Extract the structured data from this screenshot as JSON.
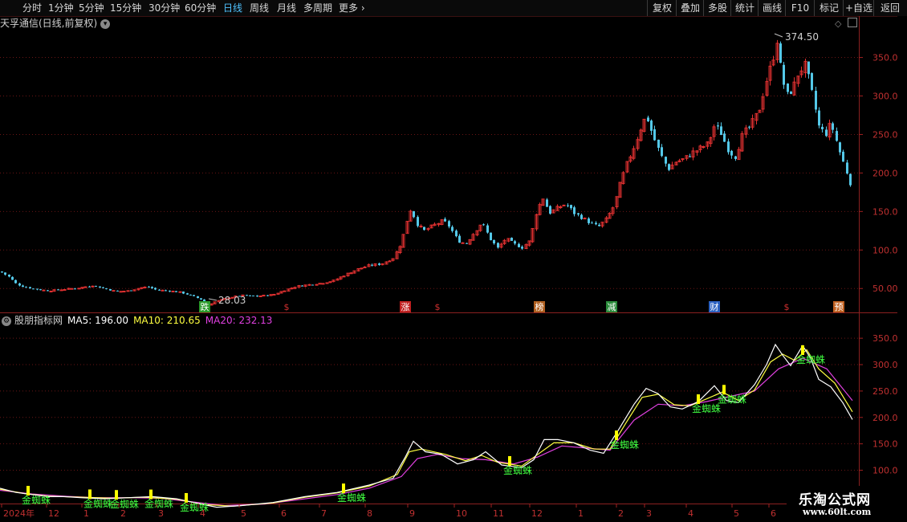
{
  "toolbar": {
    "periods": [
      "分时",
      "1分钟",
      "5分钟",
      "15分钟",
      "30分钟",
      "60分钟",
      "日线",
      "周线",
      "月线",
      "多周期",
      "更多 ›"
    ],
    "active_period": "日线",
    "right_buttons": [
      "复权",
      "叠加",
      "多股",
      "统计",
      "画线",
      "F10",
      "标记",
      "+自选",
      "返回"
    ]
  },
  "main_header": {
    "title": "天孚通信(日线,前复权)"
  },
  "indicator_header": {
    "name": "股朋指标网",
    "ma5": "MA5: 196.00",
    "ma10": "MA10: 210.65",
    "ma20": "MA20: 232.13"
  },
  "colors": {
    "up": "#e03030",
    "down": "#54c8e8",
    "ma5": "#ffffff",
    "ma10": "#ffff40",
    "ma20": "#e040e0",
    "signal_text": "#40ff40",
    "grid": "#6a1515",
    "axis_text": "#c03030"
  },
  "main_axis": {
    "ticks": [
      "350.0",
      "300.0",
      "250.0",
      "200.0",
      "150.0",
      "100.0",
      "50.00"
    ]
  },
  "ind_axis": {
    "ticks": [
      "350.0",
      "300.0",
      "250.0",
      "200.0",
      "150.0",
      "100.0"
    ]
  },
  "annotations": {
    "high_label": "374.50",
    "low_label": "28.03"
  },
  "event_markers": [
    {
      "label": "跌",
      "color": "#2a9a2a"
    },
    {
      "label": "$",
      "color": "#d03030"
    },
    {
      "label": "涨",
      "color": "#c02020"
    },
    {
      "label": "$",
      "color": "#d03030"
    },
    {
      "label": "榜",
      "color": "#b06020"
    },
    {
      "label": "减",
      "color": "#2a8a3a"
    },
    {
      "label": "财",
      "color": "#2a60c0"
    },
    {
      "label": "$",
      "color": "#d03030"
    },
    {
      "label": "预",
      "color": "#c06020"
    }
  ],
  "signal_label": "金蜘蛛",
  "date_axis": [
    "2024年",
    "12",
    "1",
    "2",
    "3",
    "4",
    "5",
    "6",
    "7",
    "8",
    "9",
    "10",
    "11",
    "12",
    "1",
    "2",
    "3",
    "4",
    "5",
    "6"
  ],
  "watermark": {
    "line1": "乐淘公式网",
    "line2": "www.60lt.com"
  },
  "chart_data": {
    "type": "candlestick",
    "main_ylim": [
      20,
      385
    ],
    "indicator_ylim": [
      40,
      370
    ],
    "price_path": [
      [
        0,
        72
      ],
      [
        10,
        66
      ],
      [
        20,
        56
      ],
      [
        30,
        52
      ],
      [
        45,
        49
      ],
      [
        60,
        47
      ],
      [
        80,
        49
      ],
      [
        100,
        51
      ],
      [
        115,
        54
      ],
      [
        130,
        50
      ],
      [
        145,
        46
      ],
      [
        160,
        47
      ],
      [
        175,
        51
      ],
      [
        185,
        52
      ],
      [
        195,
        48
      ],
      [
        210,
        47
      ],
      [
        225,
        45
      ],
      [
        240,
        40
      ],
      [
        252,
        35
      ],
      [
        258,
        28.03
      ],
      [
        268,
        33
      ],
      [
        285,
        38
      ],
      [
        300,
        41
      ],
      [
        320,
        40
      ],
      [
        340,
        42
      ],
      [
        355,
        48
      ],
      [
        370,
        53
      ],
      [
        385,
        55
      ],
      [
        400,
        57
      ],
      [
        415,
        60
      ],
      [
        430,
        68
      ],
      [
        445,
        75
      ],
      [
        460,
        80
      ],
      [
        475,
        82
      ],
      [
        490,
        90
      ],
      [
        500,
        110
      ],
      [
        507,
        140
      ],
      [
        512,
        155
      ],
      [
        518,
        135
      ],
      [
        528,
        125
      ],
      [
        540,
        132
      ],
      [
        552,
        138
      ],
      [
        560,
        130
      ],
      [
        570,
        112
      ],
      [
        580,
        108
      ],
      [
        590,
        122
      ],
      [
        600,
        136
      ],
      [
        610,
        115
      ],
      [
        620,
        102
      ],
      [
        630,
        115
      ],
      [
        640,
        108
      ],
      [
        650,
        103
      ],
      [
        660,
        112
      ],
      [
        668,
        150
      ],
      [
        676,
        168
      ],
      [
        684,
        148
      ],
      [
        695,
        155
      ],
      [
        705,
        160
      ],
      [
        715,
        148
      ],
      [
        725,
        142
      ],
      [
        735,
        135
      ],
      [
        745,
        130
      ],
      [
        755,
        140
      ],
      [
        765,
        158
      ],
      [
        772,
        185
      ],
      [
        780,
        210
      ],
      [
        790,
        235
      ],
      [
        798,
        258
      ],
      [
        805,
        275
      ],
      [
        812,
        252
      ],
      [
        822,
        225
      ],
      [
        832,
        205
      ],
      [
        842,
        215
      ],
      [
        852,
        218
      ],
      [
        862,
        226
      ],
      [
        872,
        232
      ],
      [
        882,
        238
      ],
      [
        890,
        262
      ],
      [
        898,
        252
      ],
      [
        906,
        232
      ],
      [
        915,
        220
      ],
      [
        925,
        250
      ],
      [
        935,
        262
      ],
      [
        945,
        280
      ],
      [
        955,
        322
      ],
      [
        962,
        345
      ],
      [
        968,
        374.5
      ],
      [
        973,
        330
      ],
      [
        980,
        300
      ],
      [
        988,
        310
      ],
      [
        995,
        332
      ],
      [
        1003,
        340
      ],
      [
        1012,
        300
      ],
      [
        1020,
        260
      ],
      [
        1028,
        250
      ],
      [
        1035,
        265
      ],
      [
        1045,
        230
      ],
      [
        1055,
        200
      ],
      [
        1062,
        178
      ]
    ],
    "ma5_path": [
      [
        0,
        66
      ],
      [
        20,
        58
      ],
      [
        40,
        54
      ],
      [
        60,
        50
      ],
      [
        80,
        50
      ],
      [
        100,
        48
      ],
      [
        130,
        46
      ],
      [
        160,
        48
      ],
      [
        190,
        50
      ],
      [
        220,
        46
      ],
      [
        250,
        36
      ],
      [
        270,
        30
      ],
      [
        300,
        33
      ],
      [
        340,
        39
      ],
      [
        380,
        50
      ],
      [
        420,
        58
      ],
      [
        460,
        72
      ],
      [
        490,
        85
      ],
      [
        505,
        125
      ],
      [
        515,
        155
      ],
      [
        530,
        135
      ],
      [
        550,
        130
      ],
      [
        570,
        112
      ],
      [
        590,
        120
      ],
      [
        605,
        135
      ],
      [
        625,
        110
      ],
      [
        650,
        105
      ],
      [
        665,
        120
      ],
      [
        678,
        158
      ],
      [
        695,
        158
      ],
      [
        715,
        152
      ],
      [
        735,
        138
      ],
      [
        752,
        132
      ],
      [
        770,
        175
      ],
      [
        790,
        225
      ],
      [
        805,
        255
      ],
      [
        820,
        245
      ],
      [
        835,
        220
      ],
      [
        850,
        216
      ],
      [
        870,
        230
      ],
      [
        890,
        260
      ],
      [
        905,
        232
      ],
      [
        920,
        228
      ],
      [
        940,
        262
      ],
      [
        955,
        300
      ],
      [
        966,
        338
      ],
      [
        975,
        318
      ],
      [
        985,
        298
      ],
      [
        1000,
        336
      ],
      [
        1010,
        312
      ],
      [
        1020,
        272
      ],
      [
        1035,
        258
      ],
      [
        1050,
        228
      ],
      [
        1062,
        196
      ]
    ],
    "ma10_path": [
      [
        0,
        64
      ],
      [
        30,
        56
      ],
      [
        60,
        51
      ],
      [
        100,
        49
      ],
      [
        140,
        47
      ],
      [
        180,
        49
      ],
      [
        220,
        45
      ],
      [
        255,
        35
      ],
      [
        290,
        32
      ],
      [
        340,
        38
      ],
      [
        380,
        49
      ],
      [
        420,
        57
      ],
      [
        460,
        70
      ],
      [
        495,
        92
      ],
      [
        510,
        135
      ],
      [
        525,
        140
      ],
      [
        555,
        130
      ],
      [
        580,
        118
      ],
      [
        600,
        128
      ],
      [
        620,
        115
      ],
      [
        650,
        108
      ],
      [
        670,
        130
      ],
      [
        690,
        152
      ],
      [
        715,
        152
      ],
      [
        740,
        140
      ],
      [
        760,
        140
      ],
      [
        780,
        190
      ],
      [
        800,
        238
      ],
      [
        820,
        244
      ],
      [
        840,
        224
      ],
      [
        860,
        222
      ],
      [
        880,
        235
      ],
      [
        900,
        248
      ],
      [
        920,
        232
      ],
      [
        940,
        252
      ],
      [
        960,
        305
      ],
      [
        975,
        320
      ],
      [
        990,
        308
      ],
      [
        1005,
        328
      ],
      [
        1020,
        292
      ],
      [
        1040,
        265
      ],
      [
        1062,
        210.65
      ]
    ],
    "ma20_path": [
      [
        0,
        62
      ],
      [
        40,
        55
      ],
      [
        80,
        51
      ],
      [
        120,
        48
      ],
      [
        160,
        48
      ],
      [
        200,
        47
      ],
      [
        240,
        40
      ],
      [
        280,
        33
      ],
      [
        330,
        36
      ],
      [
        380,
        46
      ],
      [
        420,
        54
      ],
      [
        460,
        66
      ],
      [
        500,
        88
      ],
      [
        520,
        122
      ],
      [
        545,
        130
      ],
      [
        575,
        122
      ],
      [
        605,
        120
      ],
      [
        640,
        112
      ],
      [
        670,
        125
      ],
      [
        700,
        146
      ],
      [
        730,
        142
      ],
      [
        760,
        138
      ],
      [
        790,
        195
      ],
      [
        820,
        225
      ],
      [
        850,
        222
      ],
      [
        880,
        230
      ],
      [
        910,
        240
      ],
      [
        940,
        250
      ],
      [
        970,
        292
      ],
      [
        1000,
        312
      ],
      [
        1030,
        292
      ],
      [
        1062,
        232.13
      ]
    ],
    "signal_x": [
      35,
      112,
      145,
      188,
      232,
      428,
      635,
      768,
      870,
      902,
      1000
    ]
  }
}
